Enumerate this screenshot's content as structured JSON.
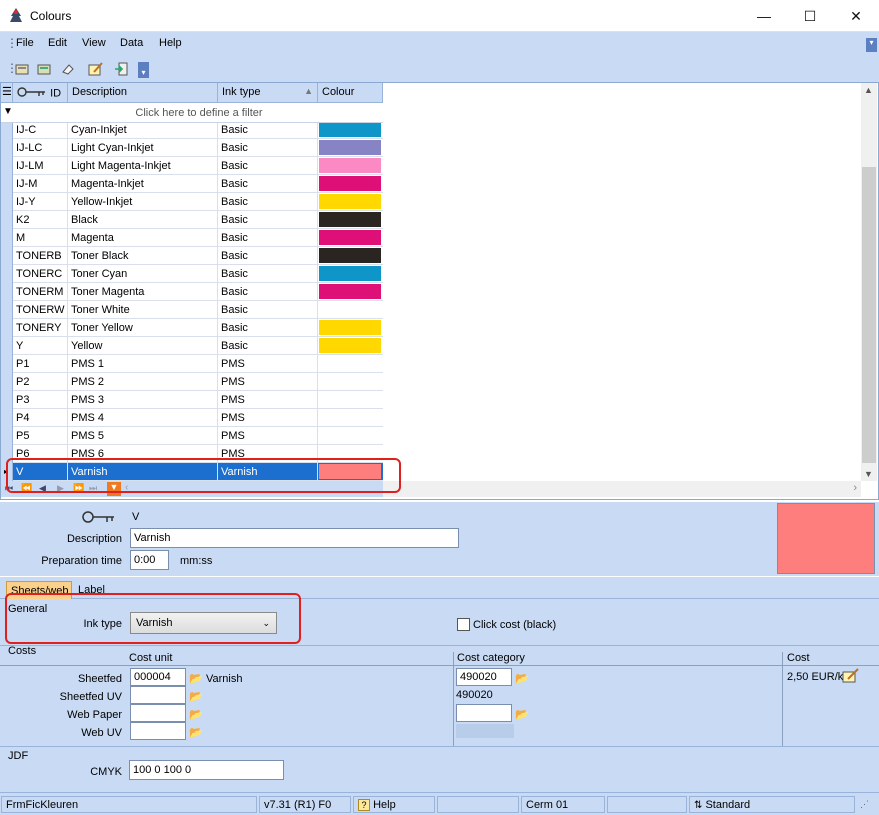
{
  "window": {
    "title": "Colours",
    "min": "—",
    "max": "☐",
    "close": "✕"
  },
  "menu": [
    "File",
    "Edit",
    "View",
    "Data",
    "Help"
  ],
  "grid": {
    "columns": {
      "id": "ID",
      "description": "Description",
      "ink_type": "Ink type",
      "colour": "Colour"
    },
    "filter_text": "Click here to define a filter",
    "rows": [
      {
        "id": "IJ-C",
        "desc": "Cyan-Inkjet",
        "ink": "Basic",
        "color": "#0e96c8"
      },
      {
        "id": "IJ-LC",
        "desc": "Light Cyan-Inkjet",
        "ink": "Basic",
        "color": "#8784c5"
      },
      {
        "id": "IJ-LM",
        "desc": "Light Magenta-Inkjet",
        "ink": "Basic",
        "color": "#fb89c3"
      },
      {
        "id": "IJ-M",
        "desc": "Magenta-Inkjet",
        "ink": "Basic",
        "color": "#de0f76"
      },
      {
        "id": "IJ-Y",
        "desc": "Yellow-Inkjet",
        "ink": "Basic",
        "color": "#ffd800"
      },
      {
        "id": "K2",
        "desc": "Black",
        "ink": "Basic",
        "color": "#2b2522"
      },
      {
        "id": "M",
        "desc": "Magenta",
        "ink": "Basic",
        "color": "#de0f76"
      },
      {
        "id": "TONERB",
        "desc": "Toner Black",
        "ink": "Basic",
        "color": "#2b2522"
      },
      {
        "id": "TONERC",
        "desc": "Toner Cyan",
        "ink": "Basic",
        "color": "#0e96c8"
      },
      {
        "id": "TONERM",
        "desc": "Toner Magenta",
        "ink": "Basic",
        "color": "#de0f76"
      },
      {
        "id": "TONERW",
        "desc": "Toner White",
        "ink": "Basic",
        "color": ""
      },
      {
        "id": "TONERY",
        "desc": "Toner Yellow",
        "ink": "Basic",
        "color": "#ffd800"
      },
      {
        "id": "Y",
        "desc": "Yellow",
        "ink": "Basic",
        "color": "#ffd800"
      },
      {
        "id": "P1",
        "desc": "PMS 1",
        "ink": "PMS",
        "color": ""
      },
      {
        "id": "P2",
        "desc": "PMS 2",
        "ink": "PMS",
        "color": ""
      },
      {
        "id": "P3",
        "desc": "PMS 3",
        "ink": "PMS",
        "color": ""
      },
      {
        "id": "P4",
        "desc": "PMS 4",
        "ink": "PMS",
        "color": ""
      },
      {
        "id": "P5",
        "desc": "PMS 5",
        "ink": "PMS",
        "color": ""
      },
      {
        "id": "P6",
        "desc": "PMS 6",
        "ink": "PMS",
        "color": ""
      },
      {
        "id": "V",
        "desc": "Varnish",
        "ink": "Varnish",
        "color": "#fe7e7e",
        "selected": true
      }
    ]
  },
  "detail": {
    "id_value": "V",
    "description_label": "Description",
    "description_value": "Varnish",
    "prep_label": "Preparation time",
    "prep_value": "0:00",
    "prep_unit": "mm:ss",
    "preview_color": "#fe7e7e"
  },
  "tabs": [
    "Sheets/web",
    "Label"
  ],
  "general": {
    "section": "General",
    "ink_type_label": "Ink type",
    "ink_type_value": "Varnish",
    "click_cost_label": "Click cost (black)"
  },
  "costs": {
    "section": "Costs",
    "cost_unit_header": "Cost unit",
    "cost_category_header": "Cost category",
    "cost_header": "Cost",
    "rows": [
      {
        "label": "Sheetfed",
        "unit": "000004",
        "unit_name": "Varnish",
        "category": "490020"
      },
      {
        "label": "Sheetfed UV",
        "unit": "",
        "unit_name": "",
        "category": "490020"
      },
      {
        "label": "Web Paper",
        "unit": "",
        "unit_name": "",
        "category": ""
      },
      {
        "label": "Web UV",
        "unit": "",
        "unit_name": "",
        "category": ""
      }
    ],
    "cost_value": "2,50 EUR/k"
  },
  "jdf": {
    "section": "JDF",
    "cmyk_label": "CMYK",
    "cmyk_value": "100 0 100 0"
  },
  "status": [
    "FrmFicKleuren",
    "v7.31 (R1) F0",
    "Help",
    "",
    "Cerm 01",
    "",
    "Standard"
  ]
}
